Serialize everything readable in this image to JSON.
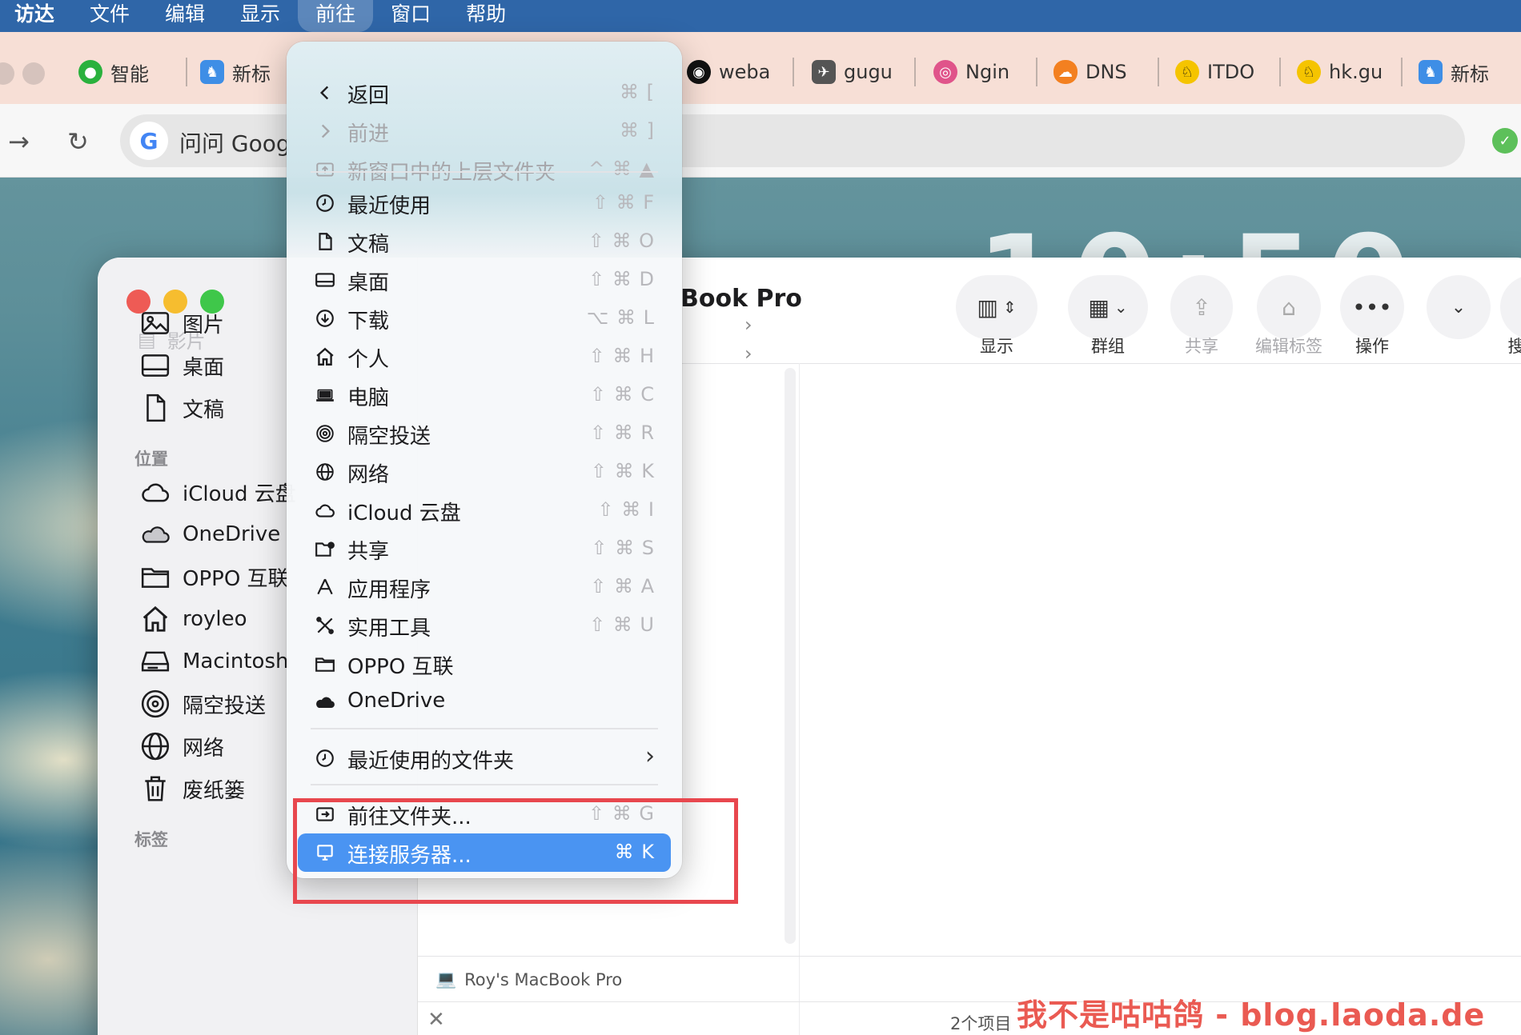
{
  "menubar": {
    "app": "访达",
    "items": [
      "文件",
      "编辑",
      "显示",
      "前往",
      "窗口",
      "帮助"
    ],
    "active": "前往"
  },
  "browser": {
    "tabs": [
      {
        "label": "智能",
        "icon": "wechat-icon",
        "color": "#2ab13d"
      },
      {
        "label": "新标",
        "icon": "bird-icon",
        "color": "#3e8ee6"
      },
      {
        "label": "weba",
        "icon": "github-icon",
        "color": "#111111"
      },
      {
        "label": "gugu",
        "icon": "pigeon-icon",
        "color": "#555555"
      },
      {
        "label": "Ngin",
        "icon": "nginx-icon",
        "color": "#e0548a"
      },
      {
        "label": "DNS",
        "icon": "cloudflare-icon",
        "color": "#f38020"
      },
      {
        "label": "ITDO",
        "icon": "horse-icon",
        "color": "#f5c400"
      },
      {
        "label": "hk.gu",
        "icon": "horse-icon",
        "color": "#f5c400"
      },
      {
        "label": "新标",
        "icon": "bird-icon",
        "color": "#3e8ee6"
      }
    ],
    "url_text": "问问 Goog",
    "google_letter": "G"
  },
  "clock_ghost": "10:50",
  "finder": {
    "title": "Book Pro",
    "sidebar_faded": "影片",
    "sidebar_favorites": [
      {
        "label": "图片",
        "icon": "photo-icon"
      },
      {
        "label": "桌面",
        "icon": "desktop-icon"
      },
      {
        "label": "文稿",
        "icon": "document-icon"
      }
    ],
    "locations_header": "位置",
    "sidebar_locations": [
      {
        "label": "iCloud 云盘",
        "icon": "icloud-icon"
      },
      {
        "label": "OneDrive",
        "icon": "onedrive-icon"
      },
      {
        "label": "OPPO 互联",
        "icon": "folder-icon"
      },
      {
        "label": "royleo",
        "icon": "home-icon"
      },
      {
        "label": "Macintosh",
        "icon": "disk-icon"
      },
      {
        "label": "隔空投送",
        "icon": "airdrop-icon"
      },
      {
        "label": "网络",
        "icon": "globe-icon"
      },
      {
        "label": "废纸篓",
        "icon": "trash-icon"
      }
    ],
    "tags_header": "标签",
    "toolbar": {
      "view_label": "显示",
      "group_label": "群组",
      "share_label": "共享",
      "tags_label": "编辑标签",
      "action_label": "操作",
      "search_label": "搜"
    },
    "path_bar": "Roy's MacBook Pro",
    "status_count": "2个项目"
  },
  "go_menu": {
    "items": [
      {
        "label": "返回",
        "shortcut": "⌘ [",
        "icon": "chevron-left-icon",
        "disabled": false
      },
      {
        "label": "前进",
        "shortcut": "⌘ ]",
        "icon": "chevron-right-icon",
        "disabled": true
      },
      {
        "label": "新窗口中的上层文件夹",
        "shortcut": "^ ⌘ ▲",
        "icon": "enclosing-folder-icon",
        "disabled": true
      },
      {
        "label": "最近使用",
        "shortcut": "⇧ ⌘ F",
        "icon": "clock-icon"
      },
      {
        "label": "文稿",
        "shortcut": "⇧ ⌘ O",
        "icon": "document-icon"
      },
      {
        "label": "桌面",
        "shortcut": "⇧ ⌘ D",
        "icon": "desktop-icon"
      },
      {
        "label": "下载",
        "shortcut": "⌥ ⌘ L",
        "icon": "download-icon"
      },
      {
        "label": "个人",
        "shortcut": "⇧ ⌘ H",
        "icon": "home-icon"
      },
      {
        "label": "电脑",
        "shortcut": "⇧ ⌘ C",
        "icon": "laptop-icon"
      },
      {
        "label": "隔空投送",
        "shortcut": "⇧ ⌘ R",
        "icon": "airdrop-icon"
      },
      {
        "label": "网络",
        "shortcut": "⇧ ⌘ K",
        "icon": "globe-icon"
      },
      {
        "label": "iCloud 云盘",
        "shortcut": "⇧ ⌘ I",
        "icon": "icloud-icon"
      },
      {
        "label": "共享",
        "shortcut": "⇧ ⌘ S",
        "icon": "shared-folder-icon"
      },
      {
        "label": "应用程序",
        "shortcut": "⇧ ⌘ A",
        "icon": "apps-icon"
      },
      {
        "label": "实用工具",
        "shortcut": "⇧ ⌘ U",
        "icon": "tools-icon"
      },
      {
        "label": "OPPO 互联",
        "shortcut": "",
        "icon": "folder-icon"
      },
      {
        "label": "OneDrive",
        "shortcut": "",
        "icon": "onedrive-icon"
      },
      {
        "label": "最近使用的文件夹",
        "shortcut": "›",
        "icon": "clock-icon"
      },
      {
        "label": "前往文件夹...",
        "shortcut": "⇧ ⌘ G",
        "icon": "goto-folder-icon"
      },
      {
        "label": "连接服务器...",
        "shortcut": "⌘ K",
        "icon": "server-icon",
        "highlighted": true
      }
    ]
  },
  "watermark": "我不是咕咕鸽 - blog.laoda.de",
  "colors": {
    "menubar": "#2f66a8",
    "highlight": "#4a94f2",
    "annotation_box": "#e8474e",
    "watermark": "#ea5a52"
  }
}
